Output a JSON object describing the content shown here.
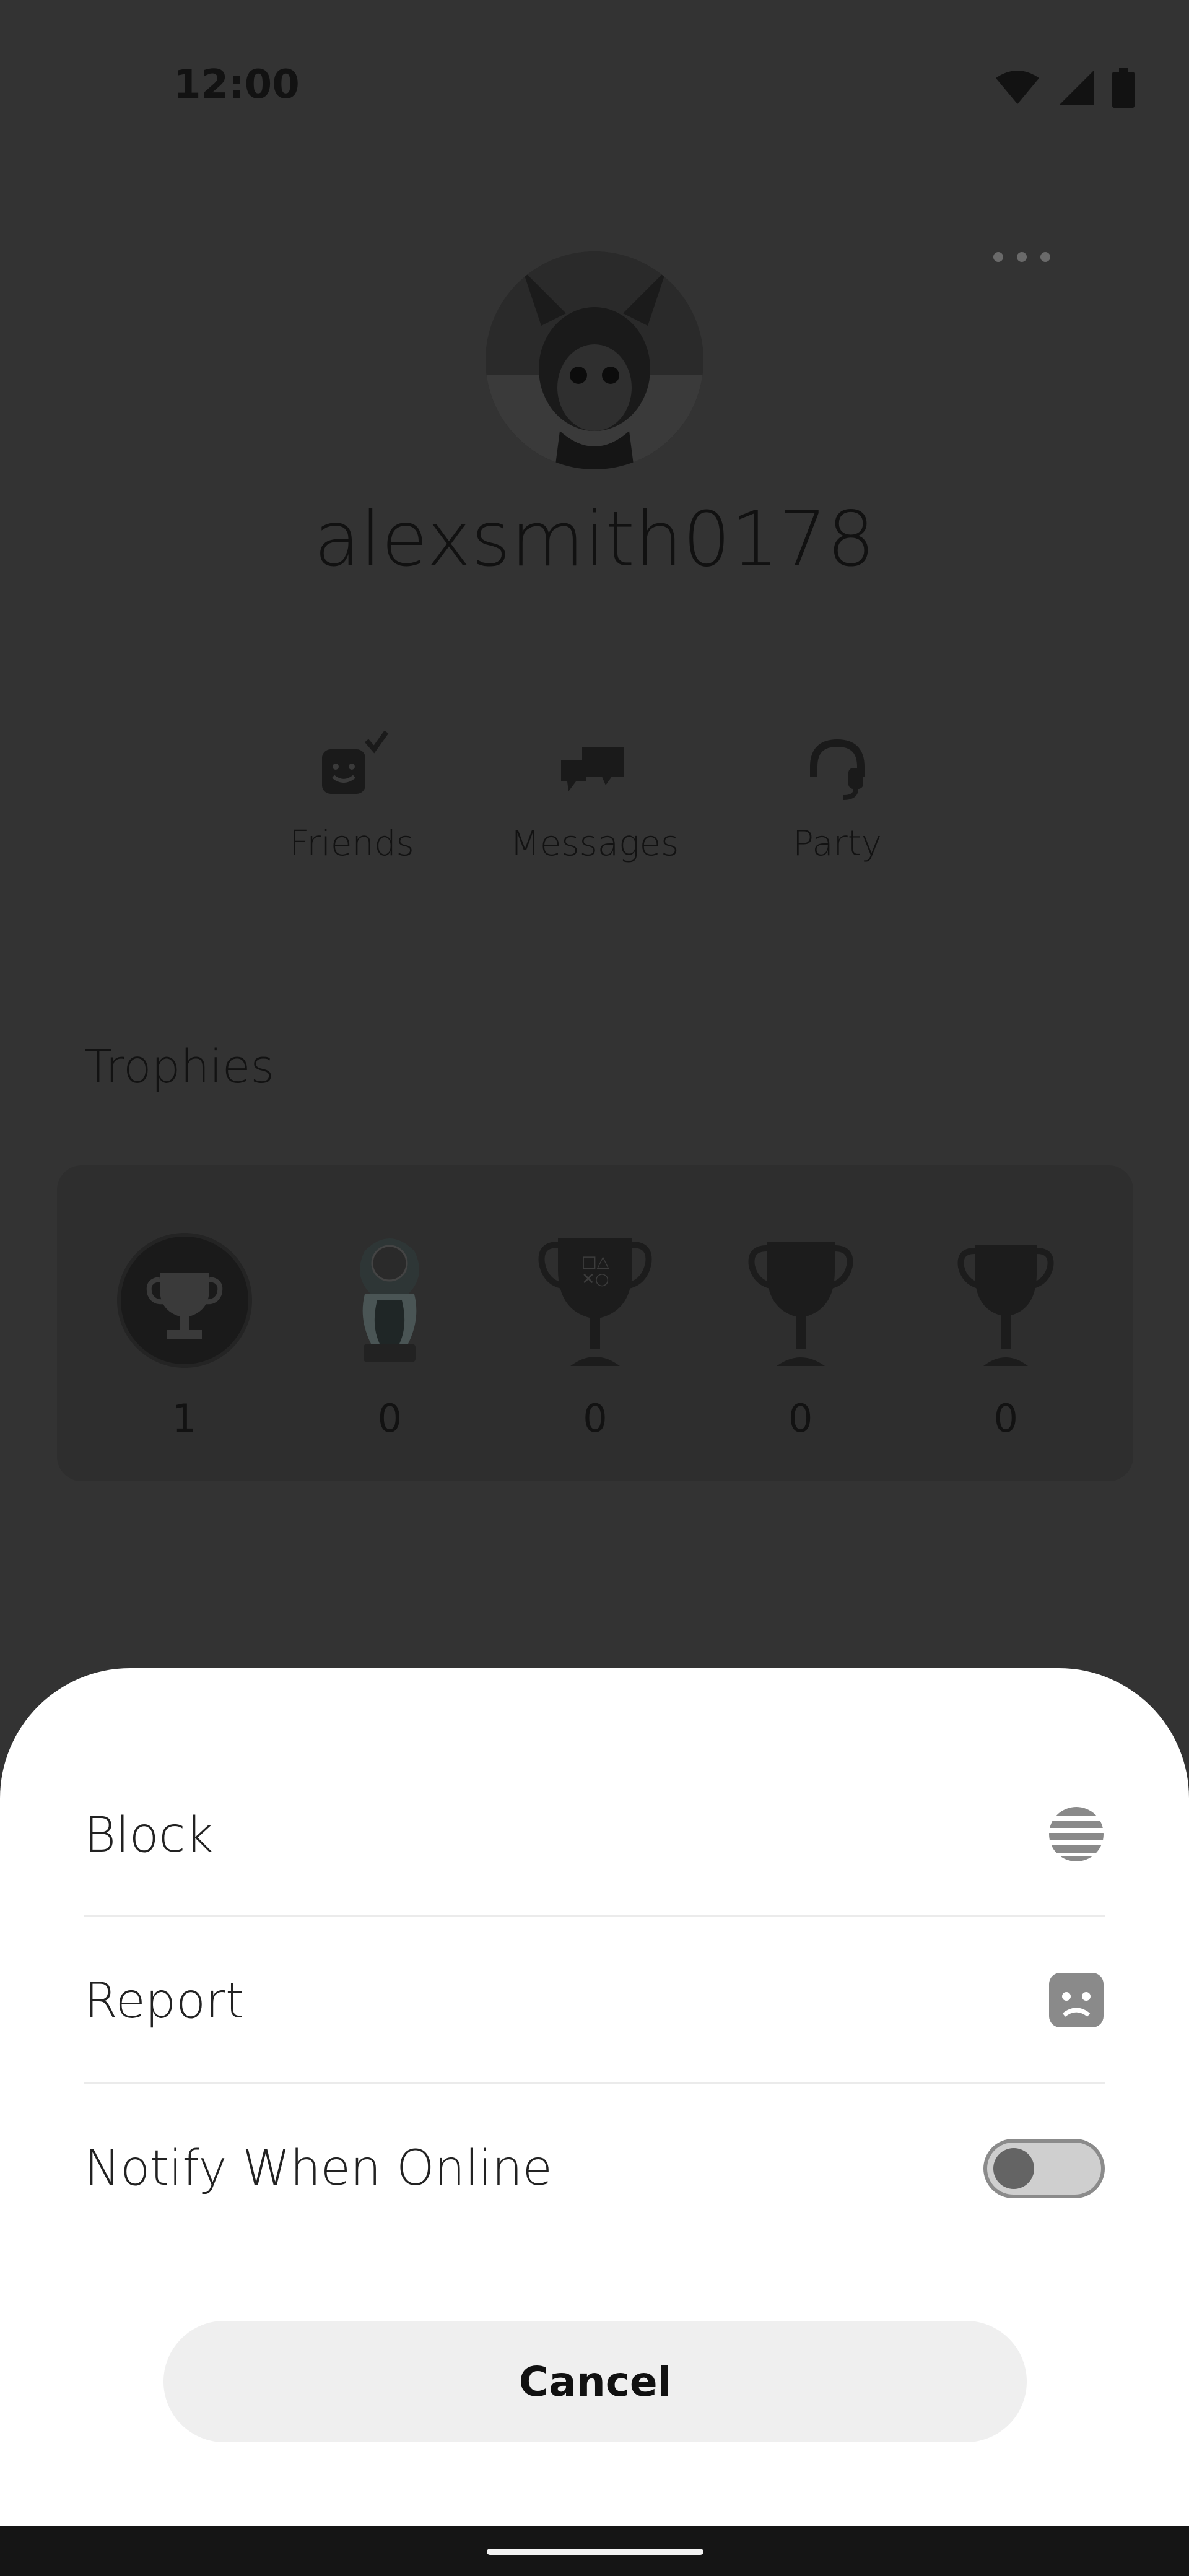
{
  "status_bar": {
    "time": "12:00",
    "icons": [
      "wifi-icon",
      "signal-icon",
      "battery-icon"
    ]
  },
  "profile": {
    "username": "alexsmith0178",
    "more_icon": "more-horizontal-icon"
  },
  "actions": [
    {
      "label": "Friends",
      "icon": "friend-check-icon"
    },
    {
      "label": "Messages",
      "icon": "chat-bubbles-icon"
    },
    {
      "label": "Party",
      "icon": "headset-icon"
    }
  ],
  "trophies": {
    "title": "Trophies",
    "items": [
      {
        "kind": "level",
        "count": "1"
      },
      {
        "kind": "platinum",
        "count": "0"
      },
      {
        "kind": "gold",
        "count": "0"
      },
      {
        "kind": "silver",
        "count": "0"
      },
      {
        "kind": "bronze",
        "count": "0"
      }
    ]
  },
  "sheet": {
    "block_label": "Block",
    "block_icon": "block-icon",
    "report_label": "Report",
    "report_icon": "report-sad-face-icon",
    "notify_label": "Notify When Online",
    "notify_enabled": false,
    "cancel_label": "Cancel"
  },
  "colors": {
    "dim_background": "#333333",
    "sheet": "#ffffff",
    "cancel_button": "#efefef",
    "toggle_track": "#cfcfcf",
    "toggle_knob": "#646464"
  }
}
